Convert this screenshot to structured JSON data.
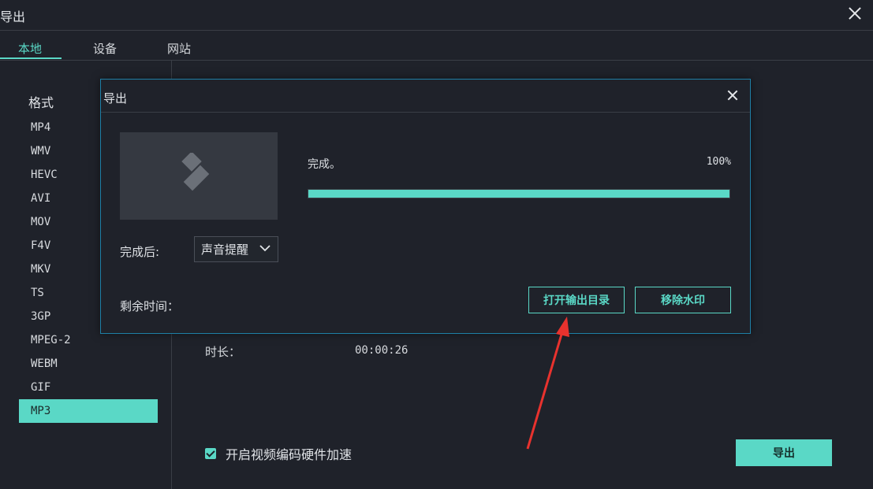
{
  "window": {
    "title": "导出"
  },
  "tabs": [
    {
      "label": "本地",
      "active": true
    },
    {
      "label": "设备",
      "active": false
    },
    {
      "label": "网站",
      "active": false
    }
  ],
  "sidebar": {
    "heading": "格式",
    "formats": [
      "MP4",
      "WMV",
      "HEVC",
      "AVI",
      "MOV",
      "F4V",
      "MKV",
      "TS",
      "3GP",
      "MPEG-2",
      "WEBM",
      "GIF",
      "MP3"
    ],
    "selected": "MP3"
  },
  "main": {
    "duration_label": "时长：",
    "duration_value": "00:00:26",
    "hw_accel_label": "开启视频编码硬件加速",
    "hw_accel_checked": true,
    "export_button": "导出"
  },
  "dialog": {
    "title": "导出",
    "status": "完成。",
    "progress_percent": 100,
    "progress_label": "100%",
    "after_label": "完成后:",
    "after_select_value": "声音提醒",
    "remaining_label": "剩余时间：",
    "open_folder_button": "打开输出目录",
    "remove_watermark_button": "移除水印"
  },
  "colors": {
    "accent": "#5ad8c6",
    "background": "#1f222a",
    "dialog_border": "#1e7fa6",
    "annotation_arrow": "#e8322e"
  }
}
